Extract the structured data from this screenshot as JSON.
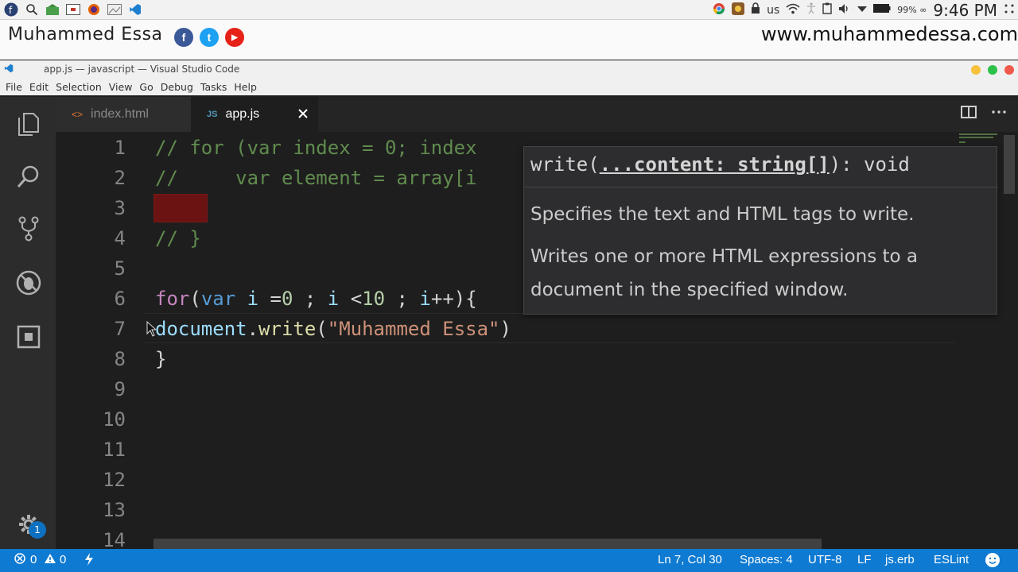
{
  "os_panel": {
    "launchers": [
      "fedora-logo-icon",
      "search-icon",
      "home-folder-icon",
      "terminal-icon",
      "firefox-icon",
      "image-viewer-icon",
      "vscode-icon"
    ],
    "tray": {
      "language": "us",
      "battery": "99% ∞",
      "clock": "9:46 PM"
    }
  },
  "banner": {
    "name": "Muhammed Essa",
    "url": "www.muhammedessa.com",
    "social": [
      {
        "name": "facebook-icon",
        "glyph": "f",
        "color": "#3b5998"
      },
      {
        "name": "twitter-icon",
        "glyph": "t",
        "color": "#1da1f2"
      },
      {
        "name": "youtube-icon",
        "glyph": "▶",
        "color": "#e62117"
      }
    ]
  },
  "window": {
    "title": "app.js — javascript — Visual Studio Code"
  },
  "menu": [
    "File",
    "Edit",
    "Selection",
    "View",
    "Go",
    "Debug",
    "Tasks",
    "Help"
  ],
  "tabs": [
    {
      "label": "index.html",
      "glyph": "<>",
      "active": false
    },
    {
      "label": "app.js",
      "glyph": "JS",
      "active": true
    }
  ],
  "editor": {
    "line_numbers": [
      "1",
      "2",
      "3",
      "4",
      "5",
      "6",
      "7",
      "8",
      "9",
      "10",
      "11",
      "12",
      "13",
      "14"
    ],
    "lines": {
      "l1": "// for (var index = 0; index ",
      "l2": "//     var element = array[i",
      "l4": "// }",
      "l6_kw": "for",
      "l6_p1": "(",
      "l6_var": "var",
      "l6_sp": " ",
      "l6_i": "i",
      "l6_eq": " =",
      "l6_zero": "0",
      "l6_semi1": " ; ",
      "l6_i2": "i",
      "l6_lt": " <",
      "l6_ten": "10",
      "l6_semi2": " ; ",
      "l6_i3": "i",
      "l6_end": "++){",
      "l7_obj": "document",
      "l7_dot": ".",
      "l7_fn": "write",
      "l7_open": "(",
      "l7_str": "\"Muhammed Essa\"",
      "l7_close": ")",
      "l8": "}"
    }
  },
  "hover": {
    "signature_fn": "write(",
    "signature_param": "...content: string[]",
    "signature_rest": "): void",
    "line1": "Specifies the text and HTML tags to write.",
    "line2": "Writes one or more HTML expressions to a document in the specified window."
  },
  "statusbar": {
    "errors": "0",
    "warnings": "0",
    "position": "Ln 7, Col 30",
    "spaces": "Spaces: 4",
    "encoding": "UTF-8",
    "eol": "LF",
    "language": "js.erb",
    "linter": "ESLint"
  },
  "activity": {
    "badge": "1"
  },
  "colors": {
    "statusbar": "#0e7ad2",
    "editor_bg": "#1e1e1e",
    "comment": "#608b4e",
    "keyword": "#c586c0",
    "string": "#ce9178"
  }
}
